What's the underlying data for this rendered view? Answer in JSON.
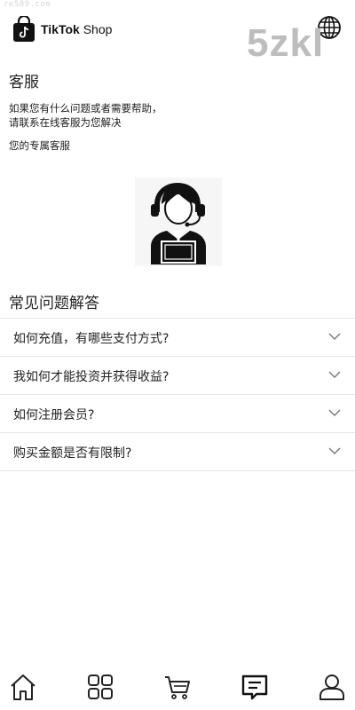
{
  "watermark_url": "re589.com",
  "watermark_brand": "5zkl",
  "header": {
    "logo_icon": "tiktok-shop-bag-icon",
    "brand_bold": "TikTok",
    "brand_light": " Shop",
    "language_icon": "globe-icon"
  },
  "customer_service": {
    "title": "客服",
    "description_line1": "如果您有什么问题或者需要帮助，",
    "description_line2": "请联系在线客服为您解决",
    "exclusive_label": "您的专属客服",
    "agent_icon": "customer-service-agent-icon"
  },
  "faq": {
    "title": "常见问题解答",
    "items": [
      {
        "question": "如何充值，有哪些支付方式?"
      },
      {
        "question": "我如何才能投资并获得收益?"
      },
      {
        "question": "如何注册会员?"
      },
      {
        "question": "购买金额是否有限制?"
      }
    ],
    "expand_icon": "chevron-down-icon"
  },
  "bottom_nav": [
    {
      "icon": "home-icon"
    },
    {
      "icon": "categories-icon"
    },
    {
      "icon": "cart-icon"
    },
    {
      "icon": "message-icon",
      "active": true
    },
    {
      "icon": "profile-icon"
    }
  ]
}
